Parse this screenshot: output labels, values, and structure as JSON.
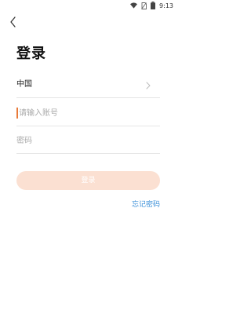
{
  "status_bar": {
    "time": "9:13",
    "icons": [
      "wifi-icon",
      "no-sim-icon",
      "battery-icon"
    ]
  },
  "header": {
    "back_icon": "chevron-left-icon",
    "title": "登录"
  },
  "form": {
    "country": {
      "value": "中国",
      "icon": "chevron-right-icon"
    },
    "account": {
      "placeholder": "请输入账号",
      "value": ""
    },
    "password": {
      "placeholder": "密码",
      "value": ""
    },
    "submit_label": "登录",
    "forgot_label": "忘记密码"
  },
  "colors": {
    "caret": "#e87a3a",
    "button_bg": "#fbe0d2",
    "link": "#3a8fd8"
  }
}
